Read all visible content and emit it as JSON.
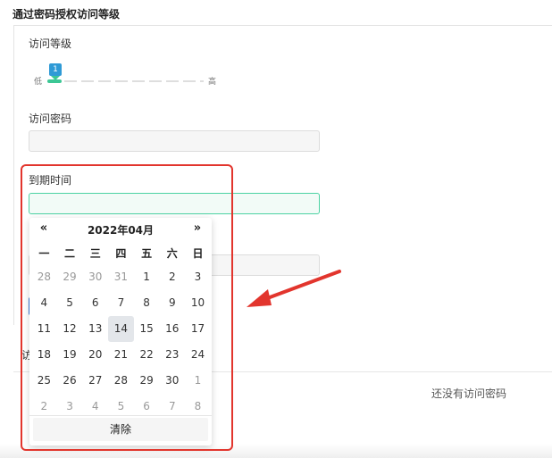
{
  "section": {
    "title": "通过密码授权访问等级"
  },
  "form": {
    "access_level_label": "访问等级",
    "slider": {
      "low_label": "低",
      "high_label": "高",
      "value": "1"
    },
    "password_label": "访问密码",
    "password_value": "",
    "expiry_label": "到期时间",
    "expiry_value": ""
  },
  "list": {
    "partial_label": "访",
    "empty_text": "还没有访问密码"
  },
  "datepicker": {
    "prev": "«",
    "next": "»",
    "title": "2022年04月",
    "weekdays": [
      "一",
      "二",
      "三",
      "四",
      "五",
      "六",
      "日"
    ],
    "days": [
      {
        "d": "28",
        "muted": true
      },
      {
        "d": "29",
        "muted": true
      },
      {
        "d": "30",
        "muted": true
      },
      {
        "d": "31",
        "muted": true
      },
      {
        "d": "1"
      },
      {
        "d": "2"
      },
      {
        "d": "3"
      },
      {
        "d": "4"
      },
      {
        "d": "5"
      },
      {
        "d": "6"
      },
      {
        "d": "7"
      },
      {
        "d": "8"
      },
      {
        "d": "9"
      },
      {
        "d": "10"
      },
      {
        "d": "11"
      },
      {
        "d": "12"
      },
      {
        "d": "13"
      },
      {
        "d": "14",
        "selected": true
      },
      {
        "d": "15"
      },
      {
        "d": "16"
      },
      {
        "d": "17"
      },
      {
        "d": "18"
      },
      {
        "d": "19"
      },
      {
        "d": "20"
      },
      {
        "d": "21"
      },
      {
        "d": "22"
      },
      {
        "d": "23"
      },
      {
        "d": "24"
      },
      {
        "d": "25"
      },
      {
        "d": "26"
      },
      {
        "d": "27"
      },
      {
        "d": "28"
      },
      {
        "d": "29"
      },
      {
        "d": "30"
      },
      {
        "d": "1",
        "muted": true
      },
      {
        "d": "2",
        "muted": true
      },
      {
        "d": "3",
        "muted": true
      },
      {
        "d": "4",
        "muted": true
      },
      {
        "d": "5",
        "muted": true
      },
      {
        "d": "6",
        "muted": true
      },
      {
        "d": "7",
        "muted": true
      },
      {
        "d": "8",
        "muted": true
      }
    ],
    "clear_label": "清除"
  },
  "colors": {
    "accent": "#3cc795",
    "slider_bubble": "#2f9ad6",
    "annotation": "#e2352d",
    "selected_day": "#e3e6ea"
  },
  "icons": {
    "annotation_arrow": "arrow-left-annotation"
  }
}
